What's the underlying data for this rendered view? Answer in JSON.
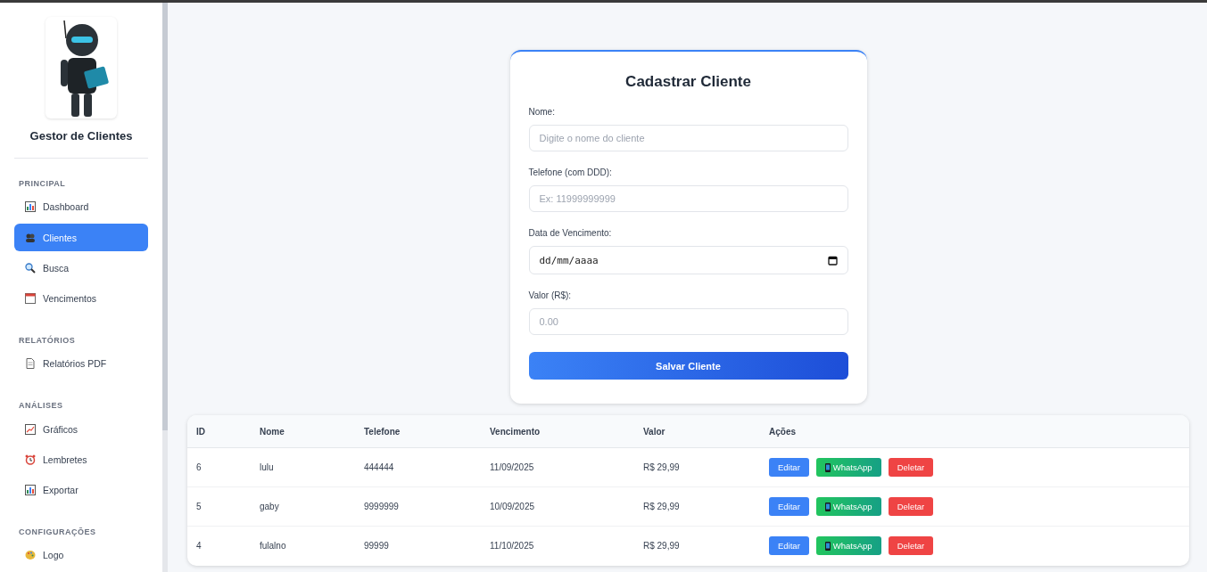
{
  "sidebar": {
    "title": "Gestor de Clientes",
    "sections": [
      {
        "heading": "PRINCIPAL",
        "items": [
          {
            "label": "Dashboard",
            "selected": false
          },
          {
            "label": "Clientes",
            "selected": true
          },
          {
            "label": "Busca",
            "selected": false
          },
          {
            "label": "Vencimentos",
            "selected": false
          }
        ]
      },
      {
        "heading": "RELATÓRIOS",
        "items": [
          {
            "label": "Relatórios PDF",
            "selected": false
          }
        ]
      },
      {
        "heading": "ANÁLISES",
        "items": [
          {
            "label": "Gráficos",
            "selected": false
          },
          {
            "label": "Lembretes",
            "selected": false
          },
          {
            "label": "Exportar",
            "selected": false
          }
        ]
      },
      {
        "heading": "CONFIGURAÇÕES",
        "items": [
          {
            "label": "Logo",
            "selected": false
          }
        ]
      }
    ]
  },
  "form": {
    "title": "Cadastrar Cliente",
    "fields": [
      {
        "kind": "text",
        "label": "Nome:",
        "placeholder": "Digite o nome do cliente"
      },
      {
        "kind": "text",
        "label": "Telefone (com DDD):",
        "placeholder": "Ex: 11999999999"
      },
      {
        "kind": "date",
        "label": "Data de Vencimento:",
        "placeholder": "dd/mm/aaaa"
      },
      {
        "kind": "text",
        "label": "Valor (R$):",
        "placeholder": "0.00"
      }
    ],
    "submit": "Salvar Cliente"
  },
  "table": {
    "columns": [
      "ID",
      "Nome",
      "Telefone",
      "Vencimento",
      "Valor",
      "Ações"
    ],
    "rows": [
      {
        "cells": [
          "6",
          "lulu",
          "444444",
          "11/09/2025",
          "R$ 29,99"
        ],
        "actions": [
          "Editar",
          "WhatsApp",
          "Deletar"
        ]
      },
      {
        "cells": [
          "5",
          "gaby",
          "9999999",
          "10/09/2025",
          "R$ 29,99"
        ],
        "actions": [
          "Editar",
          "WhatsApp",
          "Deletar"
        ]
      },
      {
        "cells": [
          "4",
          "fulalno",
          "99999",
          "11/10/2025",
          "R$ 29,99"
        ],
        "actions": [
          "Editar",
          "WhatsApp",
          "Deletar"
        ]
      }
    ]
  }
}
